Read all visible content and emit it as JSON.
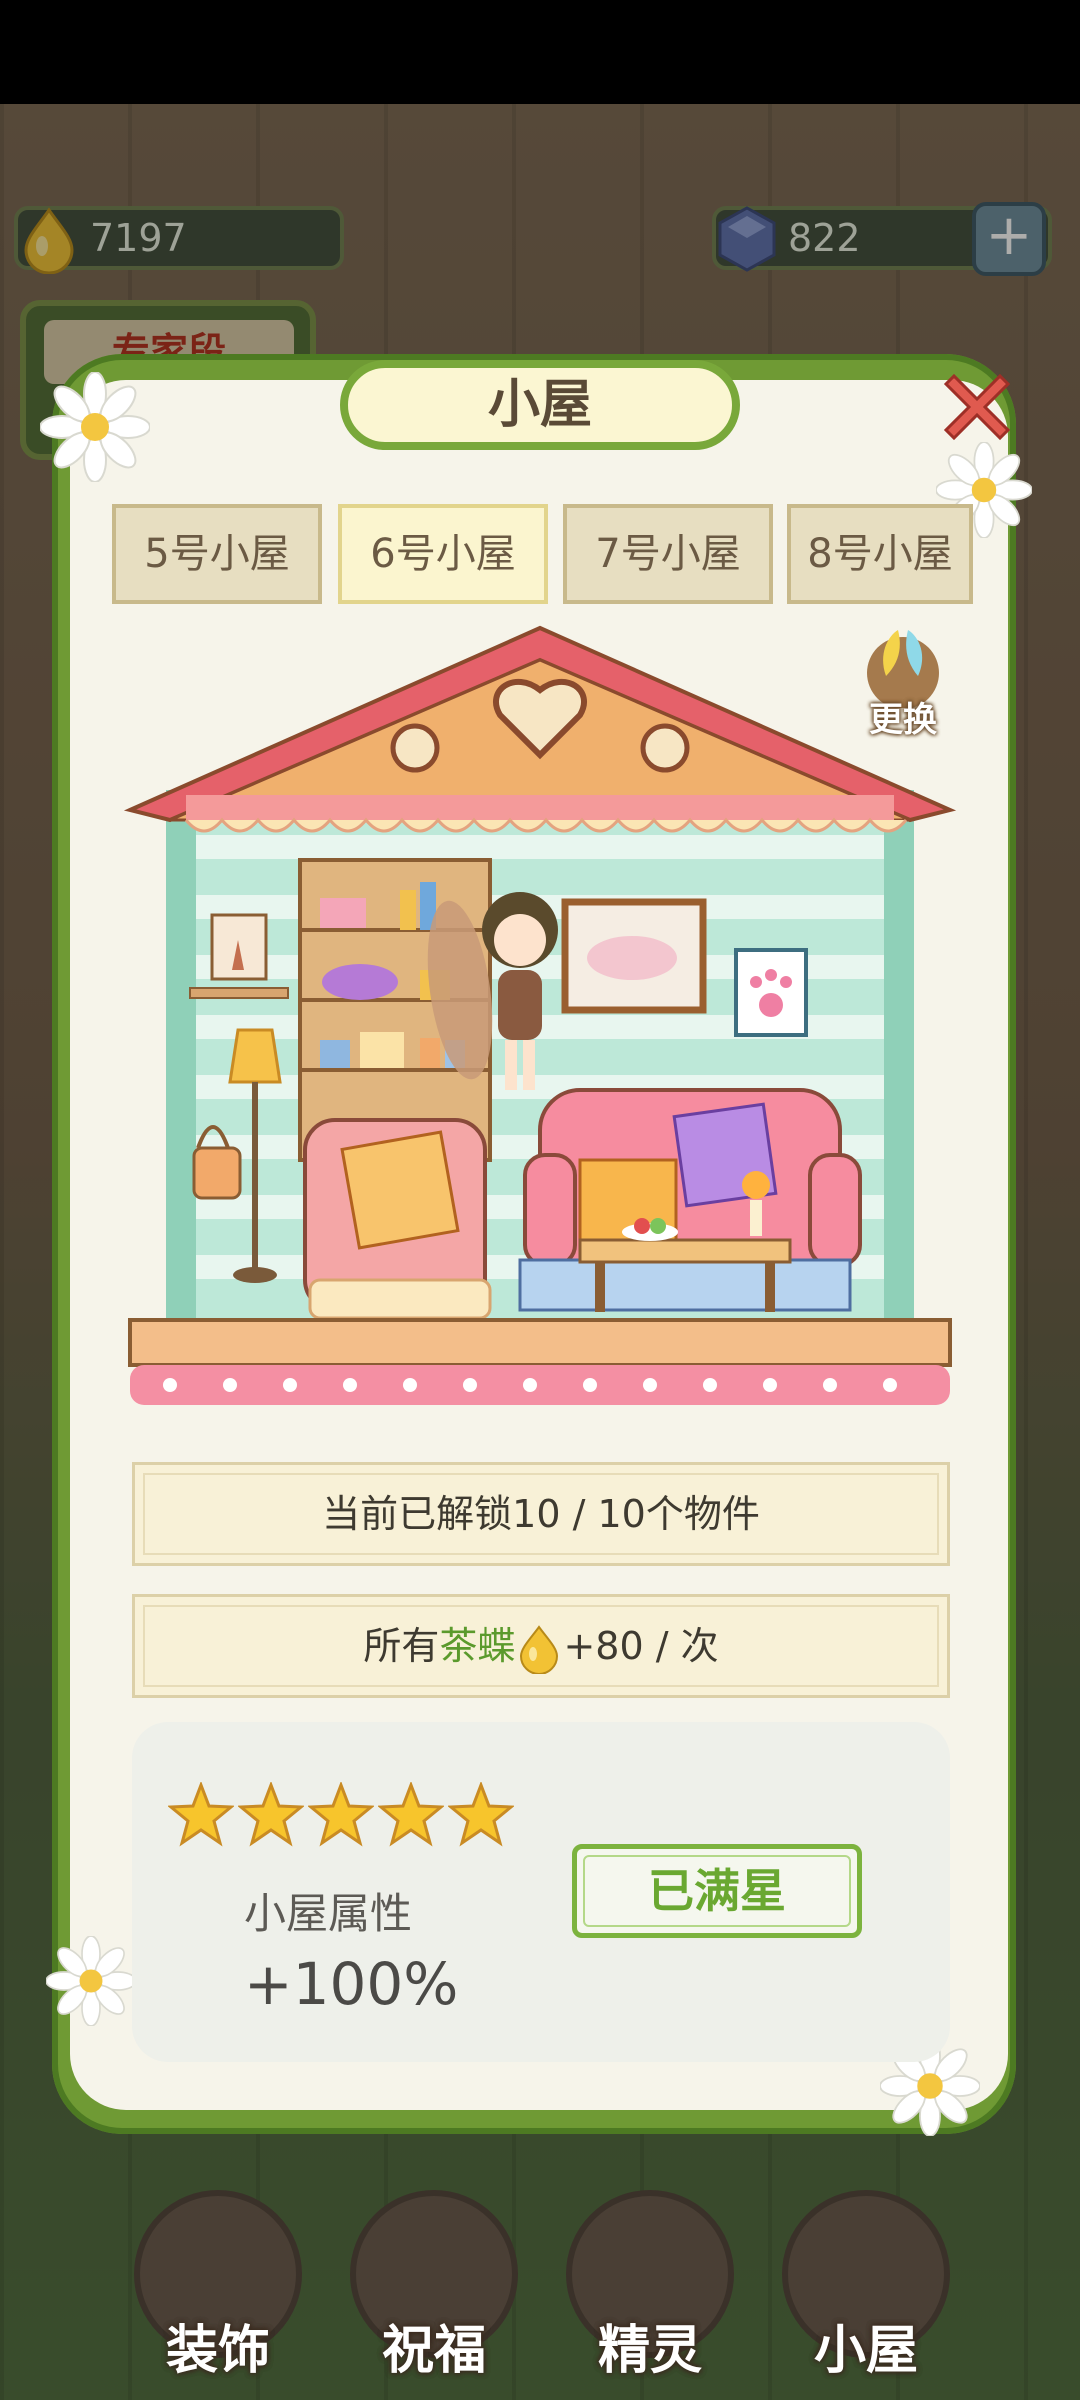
{
  "hud": {
    "leaf_count": "7197",
    "gem_count": "822",
    "plus_label": "+",
    "expert_label": "专家段"
  },
  "modal": {
    "title": "小屋",
    "tabs": [
      {
        "label": "5号小屋",
        "active": false
      },
      {
        "label": "6号小屋",
        "active": true
      },
      {
        "label": "7号小屋",
        "active": false
      },
      {
        "label": "8号小屋",
        "active": false
      }
    ],
    "change_button": "更换",
    "unlock_info": "当前已解锁10 / 10个物件",
    "bonus": {
      "prefix": "所有",
      "highlight": "茶蝶",
      "suffix": "+80 / 次"
    },
    "rating": {
      "stars": 5,
      "max_stars": 5,
      "attr_label": "小屋属性",
      "attr_value": "+100%",
      "button_label": "已满星"
    }
  },
  "nav": {
    "items": [
      {
        "label": "装饰"
      },
      {
        "label": "祝福"
      },
      {
        "label": "精灵"
      },
      {
        "label": "小屋"
      }
    ]
  },
  "colors": {
    "accent_green": "#6aa831",
    "vine": "#6f9a34",
    "panel": "#f6f4ea",
    "star": "#f7c52c",
    "close_red": "#e05a4f"
  }
}
